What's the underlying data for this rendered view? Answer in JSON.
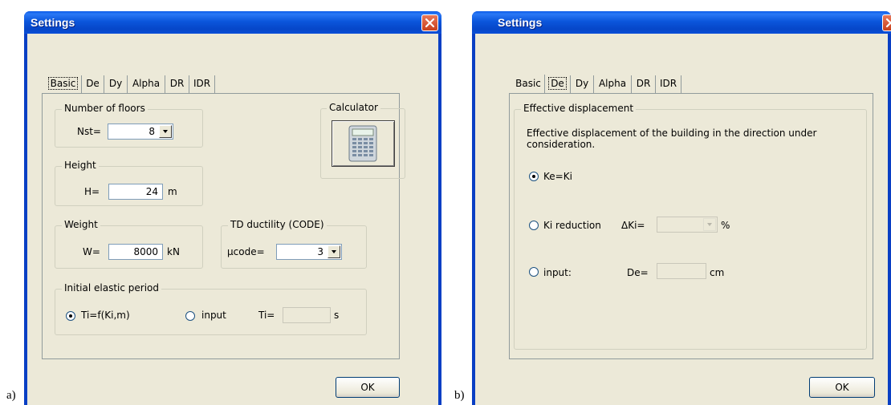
{
  "panel_a": {
    "caption": "a)",
    "window_title": "Settings",
    "tabs": [
      "Basic",
      "De",
      "Dy",
      "Alpha",
      "DR",
      "IDR"
    ],
    "active_tab": "Basic",
    "floors": {
      "title": "Number of floors",
      "label": "Nst=",
      "value": "8"
    },
    "calculator": {
      "title": "Calculator"
    },
    "height": {
      "title": "Height",
      "label": "H=",
      "value": "24",
      "unit": "m"
    },
    "weight": {
      "title": "Weight",
      "label": "W=",
      "value": "8000",
      "unit": "kN"
    },
    "ductility": {
      "title": "TD ductility (CODE)",
      "label": "μcode=",
      "value": "3"
    },
    "period": {
      "title": "Initial elastic period",
      "opt1": "Ti=f(Ki,m)",
      "opt2": "input",
      "label": "Ti=",
      "value": "",
      "unit": "s",
      "selected": "opt1"
    },
    "ok_label": "OK"
  },
  "panel_b": {
    "caption": "b)",
    "window_title": "Settings",
    "tabs": [
      "Basic",
      "De",
      "Dy",
      "Alpha",
      "DR",
      "IDR"
    ],
    "active_tab": "De",
    "group_title": "Effective displacement",
    "description": "Effective displacement of the building in the direction under consideration.",
    "opt1": "Ke=Ki",
    "opt2": "Ki reduction",
    "dki_label": "ΔKi=",
    "dki_unit": "%",
    "dki_value": "",
    "opt3": "input:",
    "de_label": "De=",
    "de_unit": "cm",
    "de_value": "",
    "selected": "opt1",
    "ok_label": "OK"
  },
  "colors": {
    "titlebar": "#0a55e0",
    "dialog_bg": "#ece9d8",
    "close_button": "#d5532d"
  }
}
